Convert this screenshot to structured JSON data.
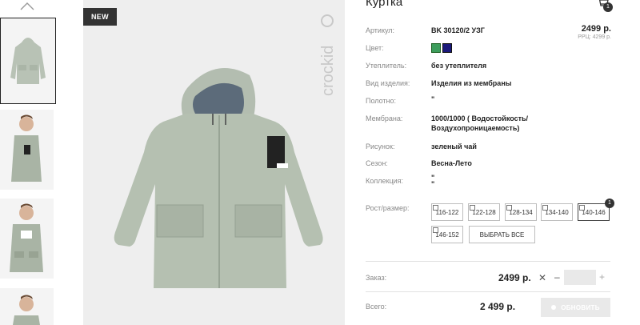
{
  "gallery": {
    "badge": "NEW",
    "brand": "crockid"
  },
  "product": {
    "title": "Куртка",
    "cart_count": "1",
    "price": "2499 р.",
    "rrp": "РРЦ: 4299 р.",
    "fields": [
      {
        "label": "Артикул:",
        "value": "BK 30120/2 УЗГ"
      },
      {
        "label": "Цвет:",
        "value": ""
      },
      {
        "label": "Утеплитель:",
        "value": "без утеплителя"
      },
      {
        "label": "Вид изделия:",
        "value": "Изделия из мембраны"
      },
      {
        "label": "Полотно:",
        "value": "\""
      },
      {
        "label": "Мембрана:",
        "value": "1000/1000 ( Водостойкость/"
      },
      {
        "label": "",
        "value": "Воздухопроницаемость)"
      },
      {
        "label": "Рисунок:",
        "value": "зеленый чай"
      },
      {
        "label": "Сезон:",
        "value": "Весна-Лето"
      },
      {
        "label": "Коллекция:",
        "value": "\""
      },
      {
        "label": "",
        "value": "\""
      }
    ],
    "colors": [
      "#3d9d5c",
      "#1b1a7a"
    ],
    "size_label": "Рост/размер:",
    "sizes": [
      "116-122",
      "122-128",
      "128-134",
      "134-140",
      "140-146",
      "146-152"
    ],
    "selected_size_count": "1",
    "select_all": "ВЫБРАТЬ ВСЕ"
  },
  "order": {
    "label": "Заказ:",
    "price": "2499 р.",
    "x": "✕",
    "minus": "–",
    "plus": "+",
    "total_label": "Всего:",
    "total": "2 499 р.",
    "update": "ОБНОВИТЬ"
  }
}
